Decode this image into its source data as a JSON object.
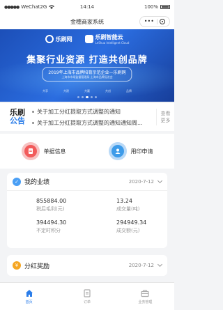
{
  "status_bar": {
    "carrier": "WeChat2G",
    "time": "14:14",
    "battery": "100%"
  },
  "nav": {
    "title": "金穗商家系统"
  },
  "banner": {
    "logo_left": "乐刷网",
    "logo_right": "乐刷智能云",
    "logo_right_sub": "LeShua Intelligent Cloud",
    "headline": "集聚行业资源  打造共创品牌",
    "pill_line1": "2019年上海市品牌培育示范企业—乐刷网",
    "pill_line2": "上海市市场监督管理局·上海市品牌促进会",
    "slogans": [
      "共享",
      "共建",
      "共赢",
      "共创",
      "品牌"
    ],
    "slide_count": 5,
    "active_slide": 2
  },
  "notice": {
    "tag_line1": "乐刷",
    "tag_line2": "公告",
    "items": [
      "关于加工分红提取方式调整的通知",
      "关于加工分红提取方式调整的通知通知周..."
    ],
    "more_line1": "查看",
    "more_line2": "更多"
  },
  "actions": [
    {
      "label": "单据信息",
      "icon": "document-icon"
    },
    {
      "label": "用印申请",
      "icon": "person-icon"
    }
  ],
  "performance": {
    "title": "我的业绩",
    "date": "2020-7-12",
    "stats": [
      {
        "value": "855884.00",
        "label": "税后毛利(元)"
      },
      {
        "value": "13.24",
        "label": "成交量(吨)"
      },
      {
        "value": "394494.30",
        "label": "不定时积分"
      },
      {
        "value": "294949.34",
        "label": "成交额(元)"
      }
    ]
  },
  "bonus": {
    "title": "分红奖励",
    "date": "2020-7-12"
  },
  "tabs": [
    {
      "label": "首页",
      "icon": "home-icon",
      "active": true
    },
    {
      "label": "订单",
      "icon": "order-icon",
      "active": false
    },
    {
      "label": "业务管理",
      "icon": "business-icon",
      "active": false
    }
  ],
  "colors": {
    "accent": "#2b7de9",
    "banner": "#1c4fb8"
  }
}
